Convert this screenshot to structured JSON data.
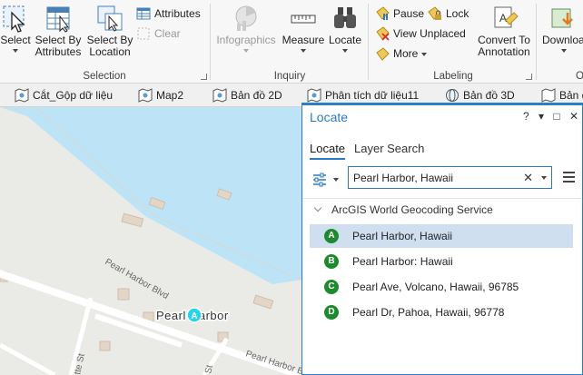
{
  "ribbon": {
    "selection": {
      "label": "Selection",
      "select": "Select",
      "select_by_attributes": "Select By Attributes",
      "select_by_location": "Select By Location",
      "attributes": "Attributes",
      "clear": "Clear"
    },
    "inquiry": {
      "label": "Inquiry",
      "infographics": "Infographics",
      "measure": "Measure",
      "locate": "Locate"
    },
    "labeling": {
      "label": "Labeling",
      "pause": "Pause",
      "lock": "Lock",
      "view_unplaced": "View Unplaced",
      "more": "More",
      "convert_to_annotation": "Convert To Annotation"
    },
    "offline": {
      "download_map": "Download Map",
      "label": "O"
    }
  },
  "map_tabs": [
    {
      "label": "Cắt_Gộp dữ liệu"
    },
    {
      "label": "Map2"
    },
    {
      "label": "Bản đồ 2D"
    },
    {
      "label": "Phân tích dữ liệu11"
    },
    {
      "label": "Bản đồ 3D"
    },
    {
      "label": "Bản đ"
    }
  ],
  "map": {
    "place_label": "Pearl Harbor",
    "marker_letter": "A",
    "roads": [
      "Pearl Harbor Blvd",
      "Pearl Harbor Blvd",
      "tte St",
      "St"
    ]
  },
  "locate_pane": {
    "title": "Locate",
    "controls": [
      "?",
      "▾",
      "□",
      "✕"
    ],
    "tabs": [
      "Locate",
      "Layer Search"
    ],
    "search_value": "Pearl Harbor, Hawaii",
    "service": "ArcGIS World Geocoding Service",
    "results": [
      {
        "letter": "A",
        "text": "Pearl Harbor, Hawaii",
        "selected": true
      },
      {
        "letter": "B",
        "text": "Pearl Harbor: Hawaii",
        "selected": false
      },
      {
        "letter": "C",
        "text": "Pearl Ave, Volcano, Hawaii, 96785",
        "selected": false
      },
      {
        "letter": "D",
        "text": "Pearl Dr, Pahoa, Hawaii, 96778",
        "selected": false
      }
    ]
  },
  "colors": {
    "accent": "#2b79c2",
    "water": "#bde3f7",
    "result_badge": "#1e8a2e",
    "marker": "#29d3e8",
    "selected_row": "#cfdff0"
  }
}
